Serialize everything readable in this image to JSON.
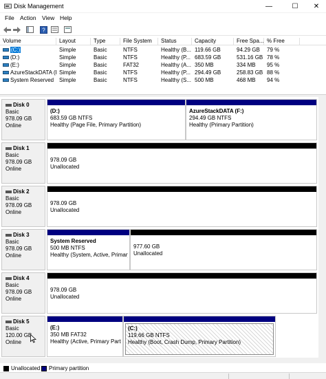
{
  "window": {
    "title": "Disk Management",
    "controls": {
      "minimize": "—",
      "maximize": "☐",
      "close": "✕"
    }
  },
  "menu": {
    "items": [
      "File",
      "Action",
      "View",
      "Help"
    ]
  },
  "toolbar": {
    "buttons": [
      "back-icon",
      "forward-icon",
      "console-tree-icon",
      "properties-icon",
      "help-icon",
      "settings-icon"
    ]
  },
  "volume_list": {
    "columns": [
      "Volume",
      "Layout",
      "Type",
      "File System",
      "Status",
      "Capacity",
      "Free Spa...",
      "% Free"
    ],
    "rows": [
      {
        "volume": "(C:)",
        "layout": "Simple",
        "type": "Basic",
        "fs": "NTFS",
        "status": "Healthy (B...",
        "capacity": "119.66 GB",
        "free": "94.29 GB",
        "pct": "79 %"
      },
      {
        "volume": "(D:)",
        "layout": "Simple",
        "type": "Basic",
        "fs": "NTFS",
        "status": "Healthy (P...",
        "capacity": "683.59 GB",
        "free": "531.16 GB",
        "pct": "78 %"
      },
      {
        "volume": "(E:)",
        "layout": "Simple",
        "type": "Basic",
        "fs": "FAT32",
        "status": "Healthy (A...",
        "capacity": "350 MB",
        "free": "334 MB",
        "pct": "95 %"
      },
      {
        "volume": "AzureStackDATA (F:)",
        "layout": "Simple",
        "type": "Basic",
        "fs": "NTFS",
        "status": "Healthy (P...",
        "capacity": "294.49 GB",
        "free": "258.83 GB",
        "pct": "88 %"
      },
      {
        "volume": "System Reserved",
        "layout": "Simple",
        "type": "Basic",
        "fs": "NTFS",
        "status": "Healthy (S...",
        "capacity": "500 MB",
        "free": "468 MB",
        "pct": "94 %"
      }
    ]
  },
  "disks": [
    {
      "name": "Disk 0",
      "type": "Basic",
      "size": "978.09 GB",
      "state": "Online",
      "partitions": [
        {
          "name": "(D:)",
          "size": "683.59 GB NTFS",
          "status": "Healthy (Page File, Primary Partition)",
          "kind": "primary"
        },
        {
          "name": "AzureStackDATA  (F:)",
          "size": "294.49 GB NTFS",
          "status": "Healthy (Primary Partition)",
          "kind": "primary"
        }
      ]
    },
    {
      "name": "Disk 1",
      "type": "Basic",
      "size": "978.09 GB",
      "state": "Online",
      "partitions": [
        {
          "name": "",
          "size": "978.09 GB",
          "status": "Unallocated",
          "kind": "unallocated"
        }
      ]
    },
    {
      "name": "Disk 2",
      "type": "Basic",
      "size": "978.09 GB",
      "state": "Online",
      "partitions": [
        {
          "name": "",
          "size": "978.09 GB",
          "status": "Unallocated",
          "kind": "unallocated"
        }
      ]
    },
    {
      "name": "Disk 3",
      "type": "Basic",
      "size": "978.09 GB",
      "state": "Online",
      "partitions": [
        {
          "name": "System Reserved",
          "size": "500 MB NTFS",
          "status": "Healthy (System, Active, Primary",
          "kind": "primary"
        },
        {
          "name": "",
          "size": "977.60 GB",
          "status": "Unallocated",
          "kind": "unallocated"
        }
      ]
    },
    {
      "name": "Disk 4",
      "type": "Basic",
      "size": "978.09 GB",
      "state": "Online",
      "partitions": [
        {
          "name": "",
          "size": "978.09 GB",
          "status": "Unallocated",
          "kind": "unallocated"
        }
      ]
    },
    {
      "name": "Disk 5",
      "type": "Basic",
      "size": "120.00 GB",
      "state": "Online",
      "partitions": [
        {
          "name": "(E:)",
          "size": "350 MB FAT32",
          "status": "Healthy (Active, Primary Partit",
          "kind": "primary"
        },
        {
          "name": "(C:)",
          "size": "119.66 GB NTFS",
          "status": "Healthy (Boot, Crash Dump, Primary Partition)",
          "kind": "primary"
        }
      ]
    }
  ],
  "legend": {
    "items": [
      {
        "label": "Unallocated",
        "color": "#000000"
      },
      {
        "label": "Primary partition",
        "color": "#000080"
      }
    ]
  },
  "colors": {
    "primary_bar": "#000080",
    "unallocated_bar": "#000000",
    "selection": "#0078d7"
  }
}
